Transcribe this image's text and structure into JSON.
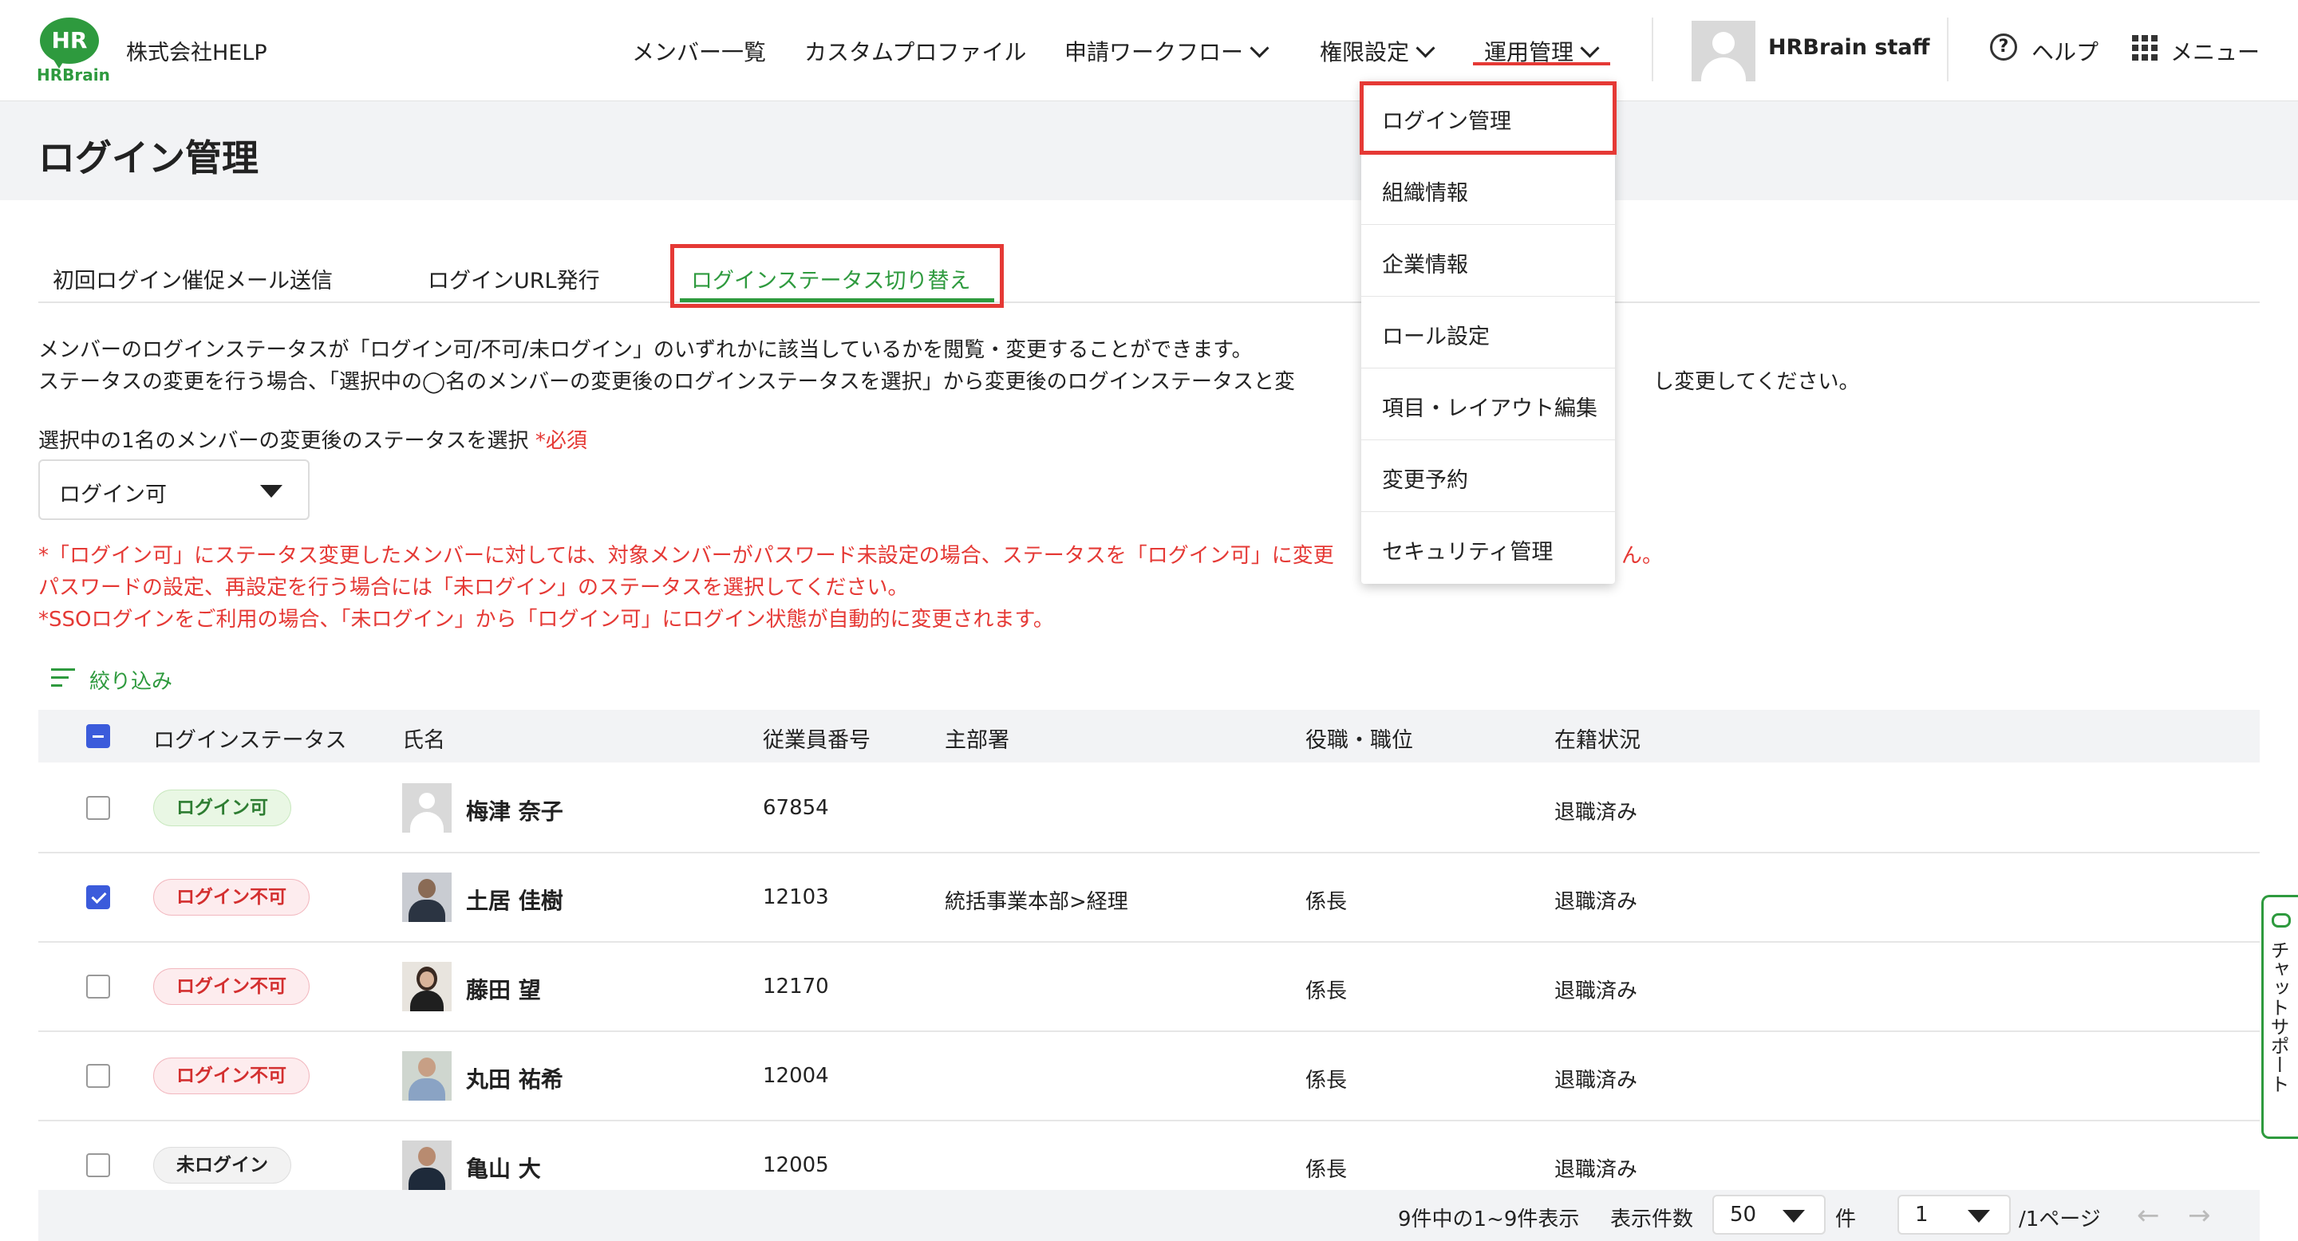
{
  "header": {
    "logo_text_top": "HR",
    "logo_text_bottom": "HRBrain",
    "company": "株式会社HELP",
    "nav": {
      "members": "メンバー一覧",
      "custom_profile": "カスタムプロファイル",
      "workflow": "申請ワークフロー",
      "permissions": "権限設定",
      "operations": "運用管理"
    },
    "user": "HRBrain staff",
    "help": "ヘルプ",
    "menu": "メニュー"
  },
  "page": {
    "title": "ログイン管理"
  },
  "tabs": {
    "t1": "初回ログイン催促メール送信",
    "t2": "ログインURL発行",
    "t3": "ログインステータス切り替え"
  },
  "description": {
    "line1": "メンバーのログインステータスが「ログイン可/不可/未ログイン」のいずれかに該当しているかを閲覧・変更することができます。",
    "line2": "ステータスの変更を行う場合、「選択中の◯名のメンバーの変更後のログインステータスを選択」から変更後のログインステータスと変",
    "line2_tail": "し変更してください。"
  },
  "status_select": {
    "label": "選択中の1名のメンバーの変更後のステータスを選択",
    "required": "*必須",
    "value": "ログイン可"
  },
  "warnings": {
    "w1": "*「ログイン可」にステータス変更したメンバーに対しては、対象メンバーがパスワード未設定の場合、ステータスを「ログイン可」に変更",
    "w1_tail": "ん。",
    "w2": "パスワードの設定、再設定を行う場合には「未ログイン」のステータスを選択してください。",
    "w3": "*SSOログインをご利用の場合、「未ログイン」から「ログイン可」にログイン状態が自動的に変更されます。"
  },
  "filter": {
    "label": "絞り込み"
  },
  "table": {
    "headers": {
      "status": "ログインステータス",
      "name": "氏名",
      "employee_no": "従業員番号",
      "department": "主部署",
      "position": "役職・職位",
      "employment": "在籍状況"
    },
    "rows": [
      {
        "checked": false,
        "status": "ログイン可",
        "name": "梅津 奈子",
        "employee_no": "67854",
        "department": "",
        "position": "",
        "employment": "退職済み"
      },
      {
        "checked": true,
        "status": "ログイン不可",
        "name": "土居 佳樹",
        "employee_no": "12103",
        "department": "統括事業本部>経理",
        "position": "係長",
        "employment": "退職済み"
      },
      {
        "checked": false,
        "status": "ログイン不可",
        "name": "藤田 望",
        "employee_no": "12170",
        "department": "",
        "position": "係長",
        "employment": "退職済み"
      },
      {
        "checked": false,
        "status": "ログイン不可",
        "name": "丸田 祐希",
        "employee_no": "12004",
        "department": "",
        "position": "係長",
        "employment": "退職済み"
      },
      {
        "checked": false,
        "status": "未ログイン",
        "name": "亀山 大",
        "employee_no": "12005",
        "department": "",
        "position": "係長",
        "employment": "退職済み"
      }
    ]
  },
  "footer": {
    "summary": "9件中の1~9件表示",
    "per_page_label": "表示件数",
    "per_page_value": "50",
    "per_page_unit": "件",
    "page_value": "1",
    "page_total": "/1ページ",
    "prev": "←",
    "next": "→"
  },
  "dropdown": {
    "items": [
      "ログイン管理",
      "組織情報",
      "企業情報",
      "ロール設定",
      "項目・レイアウト編集",
      "変更予約",
      "セキュリティ管理"
    ]
  },
  "chat": {
    "label": "チャットサポート"
  },
  "colors": {
    "brand": "#2e9a3e",
    "highlight": "#e53935",
    "checkbox": "#3b5bdb"
  }
}
